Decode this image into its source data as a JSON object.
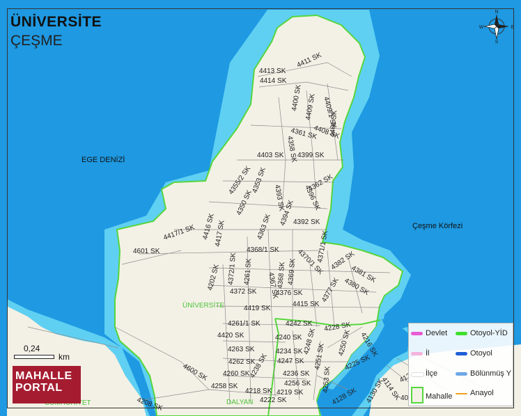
{
  "title": "ÜNİVERSİTE",
  "subtitle": "ÇEŞME",
  "colors": {
    "sea": "#1e99e2",
    "shallow": "#5fd0f2",
    "land": "#f3f1e6",
    "boundary": "#56d63c",
    "roads": "#7a7a7a",
    "label_area": "#4fc23a"
  },
  "map_labels": {
    "sea_west": "EGE DENİZİ",
    "bay": "Çeşme Körfezi",
    "neighborhood": "ÜNİVERSİTE",
    "dalyan": "DALYAN",
    "cumhuriyet": "CUMHURİYET"
  },
  "streets": [
    {
      "name": "4413 SK",
      "angle": 0
    },
    {
      "name": "4411 SK",
      "angle": -25
    },
    {
      "name": "4414 SK",
      "angle": 0
    },
    {
      "name": "4400 SK",
      "angle": -80
    },
    {
      "name": "4409 SK",
      "angle": -80
    },
    {
      "name": "4409/1 SK",
      "angle": 75
    },
    {
      "name": "4408 SK",
      "angle": 20
    },
    {
      "name": "4361 SK",
      "angle": 15
    },
    {
      "name": "4358 SK",
      "angle": 80
    },
    {
      "name": "4401 SK",
      "angle": -85
    },
    {
      "name": "4403 SK",
      "angle": 0
    },
    {
      "name": "4399 SK",
      "angle": 0
    },
    {
      "name": "4355/2 SK",
      "angle": -55
    },
    {
      "name": "4353 SK",
      "angle": -70
    },
    {
      "name": "4393 SK",
      "angle": 80
    },
    {
      "name": "4396 SK",
      "angle": 65
    },
    {
      "name": "4362 SK",
      "angle": -30
    },
    {
      "name": "4350 SK",
      "angle": -65
    },
    {
      "name": "4394 SK",
      "angle": -70
    },
    {
      "name": "4416 SK",
      "angle": -75
    },
    {
      "name": "4417/1 SK",
      "angle": -20
    },
    {
      "name": "4417 SK",
      "angle": -80
    },
    {
      "name": "4363 SK",
      "angle": -70
    },
    {
      "name": "4392 SK",
      "angle": 0
    },
    {
      "name": "4601 SK",
      "angle": 0
    },
    {
      "name": "4368/1 SK",
      "angle": 0
    },
    {
      "name": "4371/1 SK",
      "angle": -80
    },
    {
      "name": "4370/1 SK",
      "angle": 45
    },
    {
      "name": "4382 SK",
      "angle": -35
    },
    {
      "name": "4381 SK",
      "angle": 30
    },
    {
      "name": "4372/1 SK",
      "angle": -85
    },
    {
      "name": "4261 SK",
      "angle": -85
    },
    {
      "name": "4367 SK",
      "angle": 80
    },
    {
      "name": "4368 SK",
      "angle": -85
    },
    {
      "name": "4369 SK",
      "angle": -85
    },
    {
      "name": "4202 SK",
      "angle": -75
    },
    {
      "name": "4380 SK",
      "angle": 30
    },
    {
      "name": "4377 SK",
      "angle": -60
    },
    {
      "name": "4372 SK",
      "angle": 0
    },
    {
      "name": "4376 SK",
      "angle": 0
    },
    {
      "name": "4415 SK",
      "angle": 0
    },
    {
      "name": "4419 SK",
      "angle": 0
    },
    {
      "name": "4261/1 SK",
      "angle": 0
    },
    {
      "name": "4242 SK",
      "angle": 0
    },
    {
      "name": "4228 SK",
      "angle": -10
    },
    {
      "name": "4420 SK",
      "angle": 0
    },
    {
      "name": "4240 SK",
      "angle": 0
    },
    {
      "name": "4248 SK",
      "angle": -75
    },
    {
      "name": "4250 SK",
      "angle": -75
    },
    {
      "name": "4216 SK",
      "angle": 60
    },
    {
      "name": "4263 SK",
      "angle": 0
    },
    {
      "name": "4234 SK",
      "angle": 0
    },
    {
      "name": "4262 SK",
      "angle": 0
    },
    {
      "name": "4247 SK",
      "angle": 0
    },
    {
      "name": "4251 SK",
      "angle": -80
    },
    {
      "name": "4225 SK",
      "angle": -25
    },
    {
      "name": "4600 SK",
      "angle": 30
    },
    {
      "name": "4260 SK",
      "angle": 0
    },
    {
      "name": "4238 SK",
      "angle": -60
    },
    {
      "name": "4236 SK",
      "angle": 0
    },
    {
      "name": "4256 SK",
      "angle": 0
    },
    {
      "name": "4253 SK",
      "angle": -85
    },
    {
      "name": "4258 SK",
      "angle": 0
    },
    {
      "name": "4218 SK",
      "angle": 0
    },
    {
      "name": "4219 SK",
      "angle": 0
    },
    {
      "name": "4222 SK",
      "angle": 0
    },
    {
      "name": "4208 SK",
      "angle": 20
    },
    {
      "name": "4128 SK",
      "angle": -30
    },
    {
      "name": "4130 SK",
      "angle": -60
    },
    {
      "name": "4114 SK",
      "angle": 55
    },
    {
      "name": "412",
      "angle": -30
    },
    {
      "name": "40",
      "angle": 0
    }
  ],
  "scale": {
    "value": "0,24",
    "unit": "km"
  },
  "logo": {
    "line1": "MAHALLE",
    "line2": "PORTAL"
  },
  "legend": [
    {
      "label": "Devlet",
      "color": "#e85bd4",
      "kind": "line"
    },
    {
      "label": "Otoyol-YİD",
      "color": "#3ee02c",
      "kind": "line"
    },
    {
      "label": "İl",
      "color": "#f5b3dc",
      "kind": "line"
    },
    {
      "label": "Otoyol",
      "color": "#1f5fd6",
      "kind": "line"
    },
    {
      "label": "İlçe",
      "color": "#ffffff",
      "kind": "line"
    },
    {
      "label": "Bölünmüş Y",
      "color": "#6fa8e6",
      "kind": "line"
    },
    {
      "label": "Mahalle",
      "color": "#56d63c",
      "kind": "box"
    },
    {
      "label": "Anayol",
      "color": "#f0a020",
      "kind": "line"
    }
  ],
  "compass": {
    "n": "N",
    "s": "S",
    "e": "E",
    "w": "W"
  }
}
